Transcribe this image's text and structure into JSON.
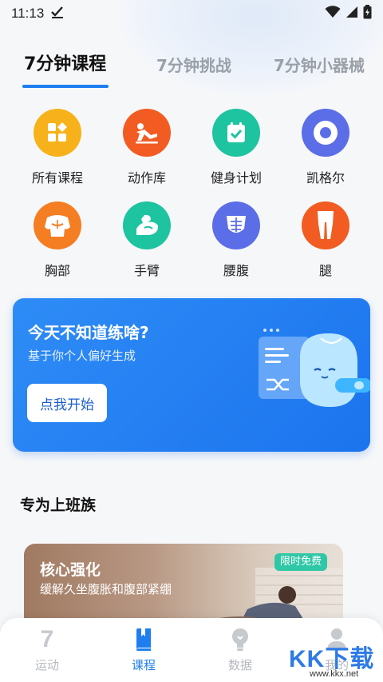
{
  "status_bar": {
    "time": "11:13"
  },
  "tabs": [
    {
      "label": "7分钟课程",
      "active": true
    },
    {
      "label": "7分钟挑战",
      "active": false
    },
    {
      "label": "7分钟小器械",
      "active": false
    }
  ],
  "categories": [
    {
      "label": "所有课程",
      "icon": "grid-icon",
      "color": "#f7b21b"
    },
    {
      "label": "动作库",
      "icon": "exercise-icon",
      "color": "#f25c22"
    },
    {
      "label": "健身计划",
      "icon": "calendar-check-icon",
      "color": "#1ec3a0"
    },
    {
      "label": "凯格尔",
      "icon": "target-ring-icon",
      "color": "#5b6ee8"
    },
    {
      "label": "胸部",
      "icon": "chest-icon",
      "color": "#f57d22"
    },
    {
      "label": "手臂",
      "icon": "arm-icon",
      "color": "#1ec3a0"
    },
    {
      "label": "腰腹",
      "icon": "abs-icon",
      "color": "#5b6ee8"
    },
    {
      "label": "腿",
      "icon": "legs-icon",
      "color": "#f25c22"
    }
  ],
  "promo": {
    "title": "今天不知道练啥?",
    "subtitle": "基于你个人偏好生成",
    "button_label": "点我开始"
  },
  "section": {
    "title": "专为上班族"
  },
  "course_card": {
    "title": "核心强化",
    "subtitle": "缓解久坐腹胀和腹部紧绷",
    "badge": "限时免费"
  },
  "bottom_nav": [
    {
      "label": "运动",
      "icon": "seven-icon",
      "active": false
    },
    {
      "label": "课程",
      "icon": "book-icon",
      "active": true
    },
    {
      "label": "数据",
      "icon": "bulb-icon",
      "active": false
    },
    {
      "label": "我的",
      "icon": "person-icon",
      "active": false
    }
  ],
  "watermark": {
    "text": "KK下载",
    "url": "www.kkx.net"
  },
  "colors": {
    "accent": "#1e7ef0",
    "promo_bg": "#2484f3",
    "badge": "#2fc7a6"
  }
}
